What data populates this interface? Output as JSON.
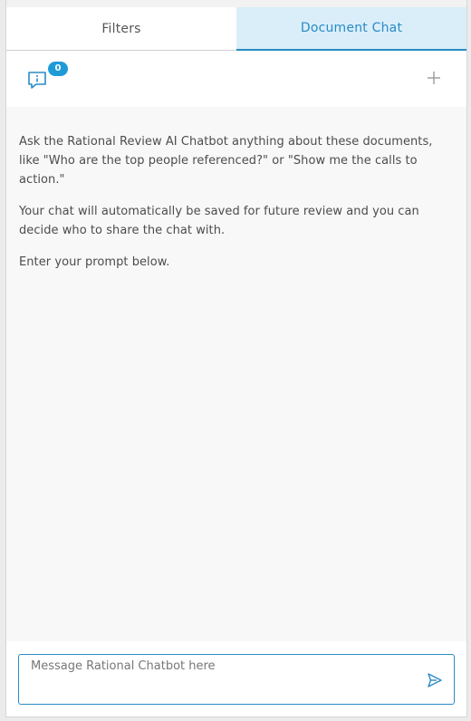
{
  "tabs": [
    {
      "label": "Filters",
      "active": false
    },
    {
      "label": "Document Chat",
      "active": true
    }
  ],
  "toolbar": {
    "chat_count": "0",
    "chat_icon": "chat-bubble-info-icon",
    "add_icon": "plus-icon"
  },
  "messages": {
    "intro": "Ask the Rational Review AI Chatbot anything about these documents, like \"Who are the top people referenced?\" or \"Show me the calls to action.\"",
    "saving": "Your chat will automatically be saved for future review and you can decide who to share the chat with.",
    "prompt": "Enter your prompt below."
  },
  "composer": {
    "placeholder": "Message Rational Chatbot here",
    "value": "",
    "send_icon": "send-icon"
  },
  "colors": {
    "accent": "#2a8bc6",
    "active_tab_bg": "#daeef9",
    "badge": "#1e9bd7",
    "chat_bg": "#f8f8f8"
  }
}
